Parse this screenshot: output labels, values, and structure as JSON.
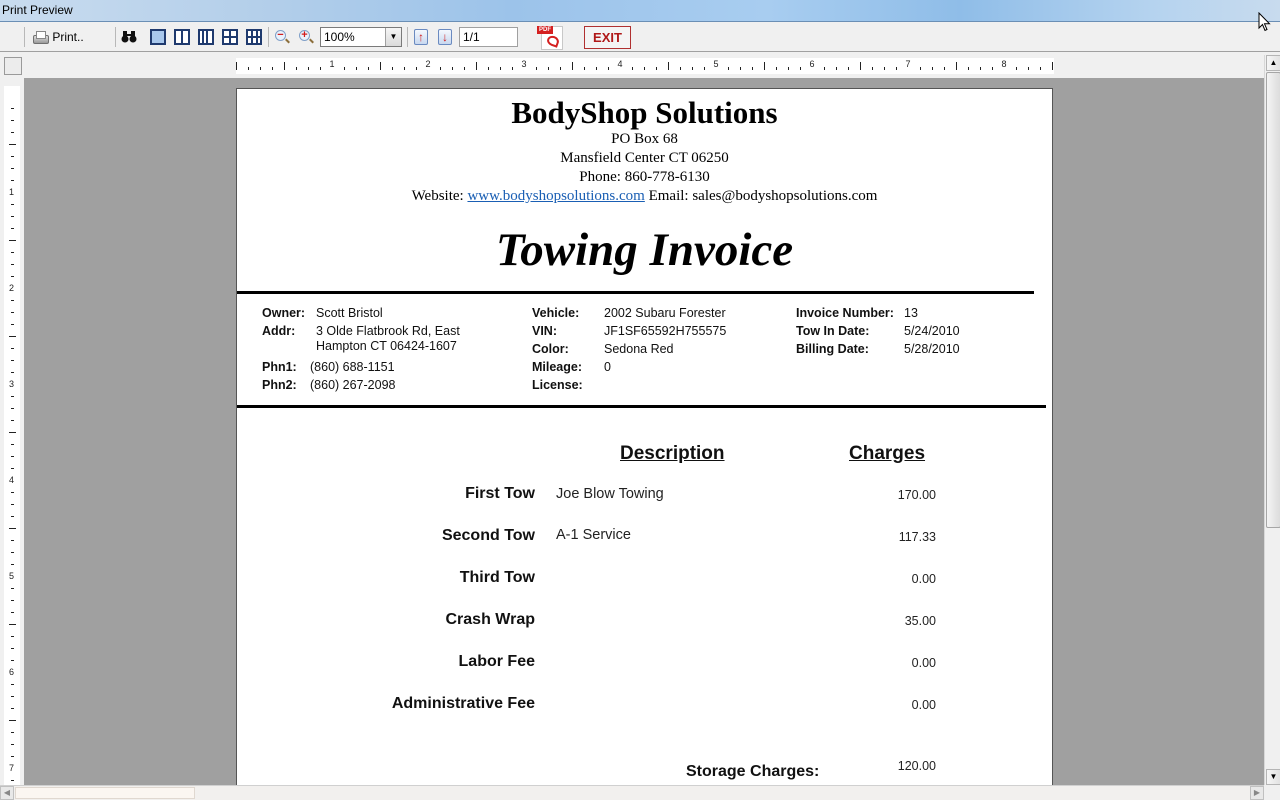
{
  "window": {
    "title": "Print Preview"
  },
  "toolbar": {
    "print_label": "Print..",
    "zoom_value": "100%",
    "page_indicator": "1/1",
    "exit_label": "EXIT",
    "pdf_badge": "PDF",
    "icons": [
      "printer-icon",
      "find-icon",
      "one-page-icon",
      "two-pages-icon",
      "three-pages-icon",
      "four-pages-icon",
      "six-pages-icon",
      "zoom-out-icon",
      "zoom-in-icon",
      "previous-page-icon",
      "next-page-icon",
      "pdf-export-icon"
    ]
  },
  "rulers": {
    "horizontal_numbers": [
      "1",
      "2",
      "3",
      "4",
      "5",
      "6",
      "7",
      "8"
    ],
    "vertical_numbers": [
      "1",
      "2",
      "3",
      "4",
      "5",
      "6",
      "7"
    ]
  },
  "company": {
    "name": "BodyShop Solutions",
    "address1": "PO Box 68",
    "address2": "Mansfield Center CT 06250",
    "phone": "Phone: 860-778-6130",
    "website_label": "Website:",
    "website": "www.bodyshopsolutions.com",
    "email_label": "Email:",
    "email": "sales@bodyshopsolutions.com"
  },
  "document_title": "Towing Invoice",
  "owner": {
    "owner_label": "Owner:",
    "owner": "Scott Bristol",
    "addr_label": "Addr:",
    "addr_line1": "3 Olde Flatbrook Rd, East",
    "addr_line2": "Hampton CT 06424-1607",
    "phn1_label": "Phn1:",
    "phn1": "(860) 688-1151",
    "phn2_label": "Phn2:",
    "phn2": "(860) 267-2098"
  },
  "vehicle": {
    "vehicle_label": "Vehicle:",
    "vehicle": "2002 Subaru Forester",
    "vin_label": "VIN:",
    "vin": "JF1SF65592H755575",
    "color_label": "Color:",
    "color": "Sedona Red",
    "mileage_label": "Mileage:",
    "mileage": "0",
    "license_label": "License:",
    "license": ""
  },
  "invoice": {
    "number_label": "Invoice Number:",
    "number": "13",
    "tow_in_label": "Tow In Date:",
    "tow_in": "5/24/2010",
    "billing_label": "Billing Date:",
    "billing": "5/28/2010"
  },
  "charges": {
    "description_header": "Description",
    "charges_header": "Charges",
    "rows": [
      {
        "label": "First Tow",
        "description": "Joe Blow Towing",
        "amount": "170.00"
      },
      {
        "label": "Second Tow",
        "description": "A-1 Service",
        "amount": "117.33"
      },
      {
        "label": "Third Tow",
        "description": "",
        "amount": "0.00"
      },
      {
        "label": "Crash Wrap",
        "description": "",
        "amount": "35.00"
      },
      {
        "label": "Labor Fee",
        "description": "",
        "amount": "0.00"
      },
      {
        "label": "Administrative Fee",
        "description": "",
        "amount": "0.00"
      }
    ],
    "storage_label": "Storage Charges:",
    "storage_amount": "120.00"
  },
  "colors": {
    "canvas_bg": "#a0a0a0",
    "link": "#1a5fb4",
    "exit": "#b01818"
  }
}
